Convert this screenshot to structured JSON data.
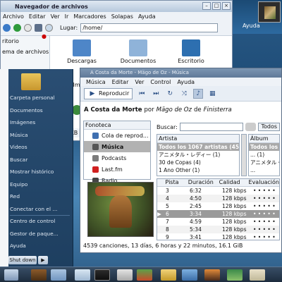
{
  "desktop": {
    "ayuda_label": "Ayuda"
  },
  "file_manager": {
    "title": "Navegador de archivos",
    "menu": [
      "Archivo",
      "Editar",
      "Ver",
      "Ir",
      "Marcadores",
      "Solapas",
      "Ayuda"
    ],
    "lugar_label": "Lugar:",
    "path": "/home/",
    "sidebar": [
      "ritorio",
      "ema de archivos"
    ],
    "icons": [
      {
        "label": "Descargas",
        "color": "#4e86c8"
      },
      {
        "label": "Documentos",
        "color": "#8fb3d9"
      },
      {
        "label": "Escritorio",
        "color": "#2d6fb0"
      }
    ],
    "icons_row2": [
      {
        "label": "Imá",
        "color": "#6da0d6"
      },
      {
        "label": "",
        "color": "#3c8b3c"
      }
    ],
    "status": "519,4 KB"
  },
  "start_menu": {
    "items": [
      "Carpeta personal",
      "Documentos",
      "Imágenes",
      "Música",
      "Videos",
      "Buscar",
      "Mostrar histórico",
      "Equipo",
      "Red",
      "Conectar con el ...",
      "Centro de control",
      "Gestor de paque...",
      "Ayuda"
    ],
    "shutdown_label": "Shut down"
  },
  "music_player": {
    "title": "A Costa da Morte - Mägo de Oz - Música",
    "menu": [
      "Música",
      "Editar",
      "Ver",
      "Control",
      "Ayuda"
    ],
    "play_label": "Reproducir",
    "now_playing": {
      "song": "A Costa da Morte",
      "by": "por",
      "artist": "Mägo de Oz",
      "from": "de",
      "album": "Finisterra"
    },
    "library_header": "Fonoteca",
    "library": [
      {
        "label": "Cola de reprod...",
        "color": "#3f6fb0"
      },
      {
        "label": "Música",
        "color": "#555"
      },
      {
        "label": "Podcasts",
        "color": "#7b7b7b"
      },
      {
        "label": "Last.fm",
        "color": "#d02020"
      },
      {
        "label": "Radio",
        "color": "#444"
      }
    ],
    "search_label": "Buscar:",
    "todo_label": "Todos",
    "artist_header": "Artista",
    "artists": [
      "Todos los 1067 artistas (4539",
      "アニメタル・レディー (1)",
      "30 de Copas (4)",
      "1 Ano Other (1)"
    ],
    "album_header": "Álbum",
    "albums": [
      "Todos los 138",
      "... (1)",
      "アニメタル・レ",
      "..."
    ],
    "track_headers": [
      "Pista",
      "Duración",
      "Calidad",
      "Evaluación"
    ],
    "tracks": [
      {
        "n": "3",
        "d": "6:32",
        "q": "128 kbps",
        "r": "• • • • •"
      },
      {
        "n": "4",
        "d": "4:50",
        "q": "128 kbps",
        "r": "• • • • •"
      },
      {
        "n": "5",
        "d": "2:45",
        "q": "128 kbps",
        "r": "• • • • •"
      },
      {
        "n": "6",
        "d": "3:34",
        "q": "128 kbps",
        "r": "• • • • •"
      },
      {
        "n": "7",
        "d": "4:59",
        "q": "128 kbps",
        "r": "• • • • •"
      },
      {
        "n": "8",
        "d": "5:34",
        "q": "128 kbps",
        "r": "• • • • •"
      },
      {
        "n": "9",
        "d": "3:41",
        "q": "128 kbps",
        "r": "• • • • •"
      }
    ],
    "status": "4539 canciones, 13 días, 6 horas y 22 minutos, 16.1 GiB"
  }
}
